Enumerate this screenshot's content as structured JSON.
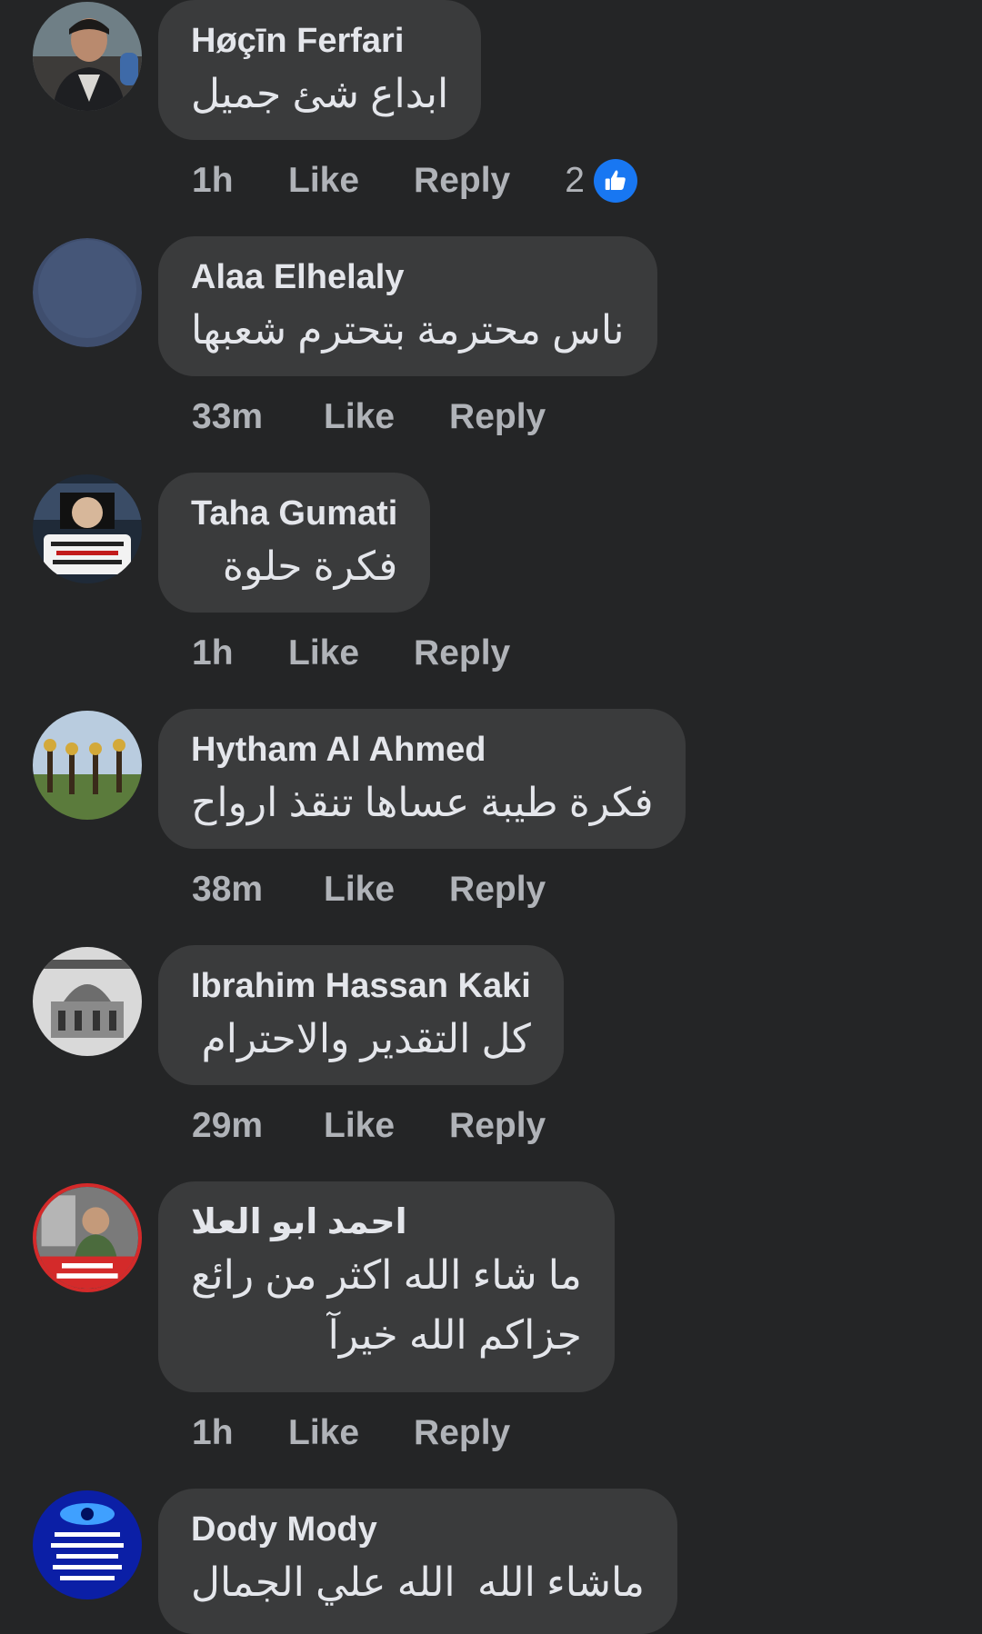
{
  "colors": {
    "background": "#242526",
    "bubble": "#3a3b3c",
    "meta_text": "#b0b3b8",
    "like_blue": "#1877f2"
  },
  "actions": {
    "like": "Like",
    "reply": "Reply"
  },
  "comments": [
    {
      "author": "Høçīn Ferfari",
      "text": [
        "ابداع شئ جميل"
      ],
      "time": "1h",
      "reactions": {
        "count": "2",
        "icon": "thumbs-up-icon"
      }
    },
    {
      "author": "Alaa Elhelaly",
      "text": [
        "ناس محترمة بتحترم شعبها"
      ],
      "time": "33m"
    },
    {
      "author": "Taha Gumati",
      "text": [
        "فكرة حلوة"
      ],
      "time": "1h"
    },
    {
      "author": "Hytham Al Ahmed",
      "text": [
        "فكرة طيبة عساها تنقذ ارواح"
      ],
      "time": "38m"
    },
    {
      "author": "Ibrahim Hassan Kaki",
      "text": [
        "كل التقدير والاحترام"
      ],
      "time": "29m"
    },
    {
      "author": "احمد ابو العلا",
      "text": [
        "ما شاء الله اكثر من رائع",
        "جزاكم الله خيرآ"
      ],
      "time": "1h"
    },
    {
      "author": "Dody Mody",
      "text": [
        "ماشاء الله  الله علي الجمال"
      ]
    }
  ]
}
